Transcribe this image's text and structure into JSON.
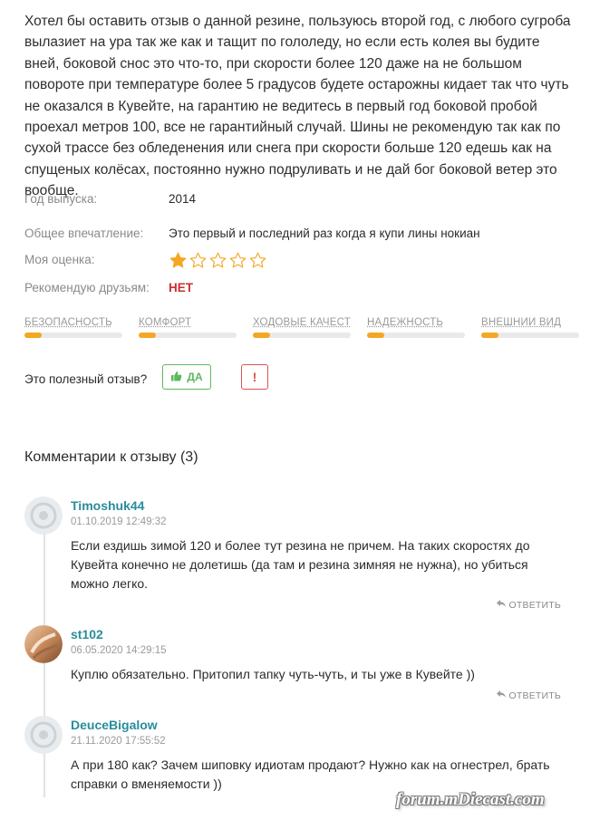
{
  "review": {
    "text": "Хотел бы оставить отзыв о данной резине, пользуюсь второй год, с любого сугроба вылазиет на ура так же как и тащит по гололеду, но если есть колея вы будите вней, боковой снос это что-то, при скорости более 120 даже на не большом повороте при температуре более 5 градусов будете остарожны кидает так что чуть не оказался в Кувейте, на гарантию не ведитесь в первый год боковой пробой проехал метров 100, все не гарантийный случай. Шины не рекомендую так как по сухой трассе без обледенения или снега при скорости больше 120 едешь как на спущеных колёсах, постоянно нужно подруливать и не дай бог боковой ветер это вообще."
  },
  "details": {
    "year_label": "Год выпуска:",
    "year_value": "2014",
    "impression_label": "Общее впечатление:",
    "impression_value": "Это первый и последний раз когда я купи лины нокиан",
    "rating_label": "Моя оценка:",
    "rating_value": 1,
    "rating_max": 5,
    "recommend_label": "Рекомендую друзьям:",
    "recommend_value": "НЕТ"
  },
  "scores": [
    {
      "label": "БЕЗОПАСНОСТЬ",
      "level": 0.18
    },
    {
      "label": "КОМФОРТ",
      "level": 0.18
    },
    {
      "label": "ХОДОВЫЕ КАЧЕСТВА",
      "level": 0.18
    },
    {
      "label": "НАДЕЖНОСТЬ",
      "level": 0.18
    },
    {
      "label": "ВНЕШНИЙ ВИД",
      "level": 0.18
    }
  ],
  "useful": {
    "question": "Это полезный отзыв?",
    "yes_label": "ДА",
    "report_label": "!"
  },
  "comments_title": "Комментарии к отзыву (3)",
  "comments": [
    {
      "author": "Timoshuk44",
      "date": "01.10.2019 12:49:32",
      "text": "Если ездишь зимой 120 и более тут резина не причем. На таких скоростях до Кувейта конечно не долетишь (да там и резина зимняя не нужна), но убиться можно легко.",
      "reply": "ОТВЕТИТЬ"
    },
    {
      "author": "st102",
      "date": "06.05.2020 14:29:15",
      "text": "Куплю обязательно. Притопил тапку чуть-чуть, и ты уже в Кувейте ))",
      "reply": "ОТВЕТИТЬ"
    },
    {
      "author": "DeuceBigalow",
      "date": "21.11.2020 17:55:52",
      "text": "А при 180 как? Зачем шиповку идиотам продают? Нужно как на огнестрел, брать справки о вменяемости ))",
      "reply": ""
    }
  ],
  "watermark": "forum.mDiecast.com",
  "colors": {
    "accent": "#f5a623",
    "author": "#2a8c9b",
    "negative": "#c9302c",
    "positive": "#5cb85c"
  }
}
